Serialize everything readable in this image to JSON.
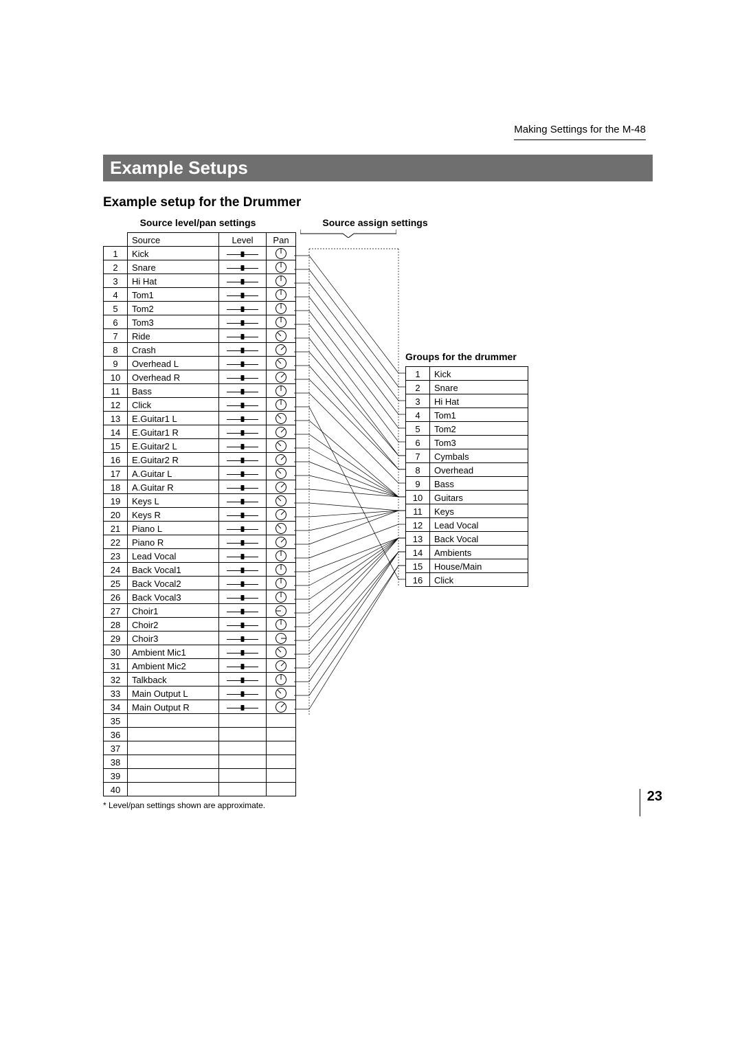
{
  "header": {
    "right": "Making Settings for the M-48"
  },
  "section_title": "Example Setups",
  "subheading": "Example setup for the Drummer",
  "captions": {
    "source_levelpan": "Source level/pan settings",
    "source_assign": "Source assign settings",
    "groups": "Groups for the drummer"
  },
  "source_headers": {
    "source": "Source",
    "level": "Level",
    "pan": "Pan"
  },
  "footnote": "* Level/pan settings shown are approximate.",
  "page_number": "23",
  "sources": [
    {
      "n": 1,
      "name": "Kick",
      "pan": 0,
      "group": 1
    },
    {
      "n": 2,
      "name": "Snare",
      "pan": 0,
      "group": 2
    },
    {
      "n": 3,
      "name": "Hi Hat",
      "pan": 0,
      "group": 3
    },
    {
      "n": 4,
      "name": "Tom1",
      "pan": 0,
      "group": 4
    },
    {
      "n": 5,
      "name": "Tom2",
      "pan": 0,
      "group": 5
    },
    {
      "n": 6,
      "name": "Tom3",
      "pan": 0,
      "group": 6
    },
    {
      "n": 7,
      "name": "Ride",
      "pan": -45,
      "group": 7
    },
    {
      "n": 8,
      "name": "Crash",
      "pan": 45,
      "group": 7
    },
    {
      "n": 9,
      "name": "Overhead L",
      "pan": -45,
      "group": 8
    },
    {
      "n": 10,
      "name": "Overhead R",
      "pan": 45,
      "group": 8
    },
    {
      "n": 11,
      "name": "Bass",
      "pan": 0,
      "group": 9
    },
    {
      "n": 12,
      "name": "Click",
      "pan": 0,
      "group": 16
    },
    {
      "n": 13,
      "name": "E.Guitar1 L",
      "pan": -45,
      "group": 10
    },
    {
      "n": 14,
      "name": "E.Guitar1 R",
      "pan": 45,
      "group": 10
    },
    {
      "n": 15,
      "name": "E.Guitar2 L",
      "pan": -45,
      "group": 10
    },
    {
      "n": 16,
      "name": "E.Guitar2 R",
      "pan": 45,
      "group": 10
    },
    {
      "n": 17,
      "name": "A.Guitar L",
      "pan": -45,
      "group": 10
    },
    {
      "n": 18,
      "name": "A.Guitar R",
      "pan": 45,
      "group": 10
    },
    {
      "n": 19,
      "name": "Keys L",
      "pan": -45,
      "group": 11
    },
    {
      "n": 20,
      "name": "Keys R",
      "pan": 45,
      "group": 11
    },
    {
      "n": 21,
      "name": "Piano L",
      "pan": -45,
      "group": 11
    },
    {
      "n": 22,
      "name": "Piano R",
      "pan": 45,
      "group": 11
    },
    {
      "n": 23,
      "name": "Lead Vocal",
      "pan": 0,
      "group": 12
    },
    {
      "n": 24,
      "name": "Back Vocal1",
      "pan": 0,
      "group": 13
    },
    {
      "n": 25,
      "name": "Back Vocal2",
      "pan": 0,
      "group": 13
    },
    {
      "n": 26,
      "name": "Back Vocal3",
      "pan": 0,
      "group": 13
    },
    {
      "n": 27,
      "name": "Choir1",
      "pan": -90,
      "group": 13
    },
    {
      "n": 28,
      "name": "Choir2",
      "pan": 0,
      "group": 13
    },
    {
      "n": 29,
      "name": "Choir3",
      "pan": 90,
      "group": 13
    },
    {
      "n": 30,
      "name": "Ambient Mic1",
      "pan": -45,
      "group": 14
    },
    {
      "n": 31,
      "name": "Ambient Mic2",
      "pan": 45,
      "group": 14
    },
    {
      "n": 32,
      "name": "Talkback",
      "pan": 0,
      "group": 14
    },
    {
      "n": 33,
      "name": "Main Output L",
      "pan": -45,
      "group": 15
    },
    {
      "n": 34,
      "name": "Main Output R",
      "pan": 45,
      "group": 15
    },
    {
      "n": 35,
      "name": "",
      "pan": null,
      "group": null
    },
    {
      "n": 36,
      "name": "",
      "pan": null,
      "group": null
    },
    {
      "n": 37,
      "name": "",
      "pan": null,
      "group": null
    },
    {
      "n": 38,
      "name": "",
      "pan": null,
      "group": null
    },
    {
      "n": 39,
      "name": "",
      "pan": null,
      "group": null
    },
    {
      "n": 40,
      "name": "",
      "pan": null,
      "group": null
    }
  ],
  "groups": [
    {
      "n": 1,
      "name": "Kick"
    },
    {
      "n": 2,
      "name": "Snare"
    },
    {
      "n": 3,
      "name": "Hi Hat"
    },
    {
      "n": 4,
      "name": "Tom1"
    },
    {
      "n": 5,
      "name": "Tom2"
    },
    {
      "n": 6,
      "name": "Tom3"
    },
    {
      "n": 7,
      "name": "Cymbals"
    },
    {
      "n": 8,
      "name": "Overhead"
    },
    {
      "n": 9,
      "name": "Bass"
    },
    {
      "n": 10,
      "name": "Guitars"
    },
    {
      "n": 11,
      "name": "Keys"
    },
    {
      "n": 12,
      "name": "Lead Vocal"
    },
    {
      "n": 13,
      "name": "Back Vocal"
    },
    {
      "n": 14,
      "name": "Ambients"
    },
    {
      "n": 15,
      "name": "House/Main"
    },
    {
      "n": 16,
      "name": "Click"
    }
  ]
}
